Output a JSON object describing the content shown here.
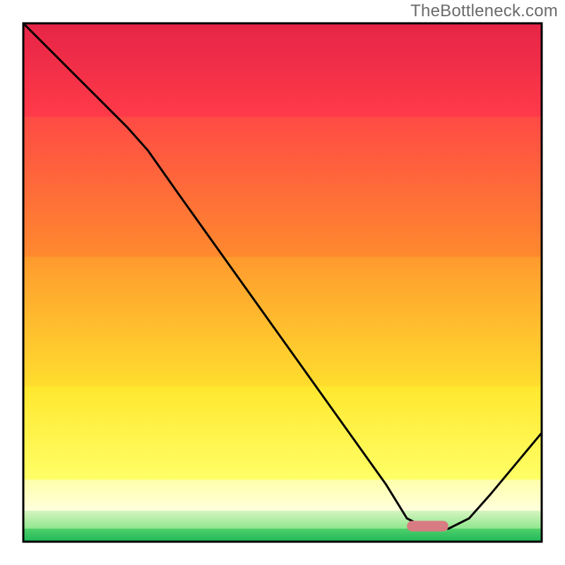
{
  "watermark": "TheBottleneck.com",
  "chart_data": {
    "type": "line",
    "title": "",
    "xlabel": "",
    "ylabel": "",
    "xlim": [
      0,
      100
    ],
    "ylim": [
      0,
      100
    ],
    "x": [
      0,
      5,
      10,
      15,
      20,
      24,
      30,
      35,
      40,
      45,
      50,
      55,
      60,
      65,
      70,
      74,
      78,
      82,
      86,
      90,
      95,
      100
    ],
    "values": [
      100,
      95,
      90,
      85,
      80,
      75.5,
      67,
      60,
      53,
      46,
      39,
      32,
      25,
      18,
      11,
      4.5,
      2.5,
      2.5,
      4.5,
      9,
      15,
      21
    ],
    "marker_segment": {
      "x_start": 74,
      "x_end": 82,
      "y": 3
    },
    "gradient_bands": [
      {
        "y_top": 100,
        "y_bottom": 82,
        "color_top": "#e62547",
        "color_bottom": "#ff3a49"
      },
      {
        "y_top": 82,
        "y_bottom": 55,
        "color_top": "#ff4a45",
        "color_bottom": "#ff8a2e"
      },
      {
        "y_top": 55,
        "y_bottom": 30,
        "color_top": "#ff9a2e",
        "color_bottom": "#ffdd2e"
      },
      {
        "y_top": 30,
        "y_bottom": 12,
        "color_top": "#ffe72e",
        "color_bottom": "#ffff66"
      },
      {
        "y_top": 12,
        "y_bottom": 6,
        "color_top": "#ffffaa",
        "color_bottom": "#ffffdd"
      },
      {
        "y_top": 6,
        "y_bottom": 2.5,
        "color_top": "#d6f5c0",
        "color_bottom": "#8fe68f"
      },
      {
        "y_top": 2.5,
        "y_bottom": 0,
        "color_top": "#4fd06a",
        "color_bottom": "#1fb85a"
      }
    ],
    "axes_visible": true,
    "grid": false
  }
}
